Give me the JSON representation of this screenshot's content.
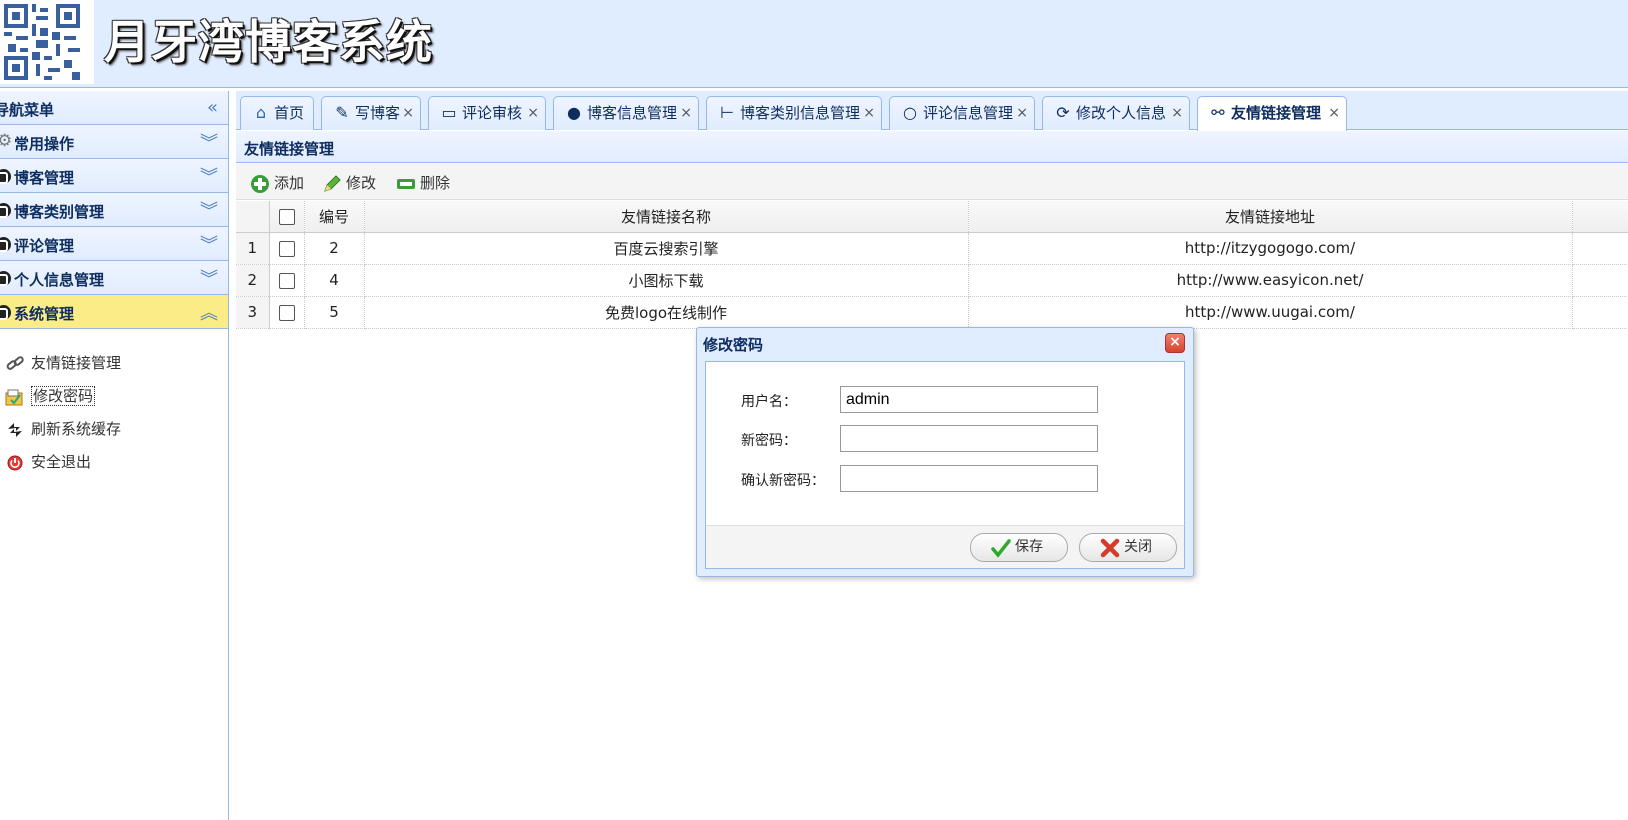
{
  "header": {
    "title": "月牙湾博客系统"
  },
  "sidebar": {
    "title": "导航菜单",
    "groups": [
      {
        "label": "常用操作"
      },
      {
        "label": "博客管理"
      },
      {
        "label": "博客类别管理"
      },
      {
        "label": "评论管理"
      },
      {
        "label": "个人信息管理"
      },
      {
        "label": "系统管理"
      }
    ],
    "items": [
      {
        "label": "友情链接管理",
        "icon": "link-icon"
      },
      {
        "label": "修改密码",
        "icon": "password-icon"
      },
      {
        "label": "刷新系统缓存",
        "icon": "refresh-icon"
      },
      {
        "label": "安全退出",
        "icon": "exit-icon"
      }
    ]
  },
  "tabs": [
    {
      "label": "首页",
      "icon": "home-icon"
    },
    {
      "label": "写博客",
      "icon": "write-icon"
    },
    {
      "label": "评论审核",
      "icon": "review-icon"
    },
    {
      "label": "博客信息管理",
      "icon": "blog-icon"
    },
    {
      "label": "博客类别信息管理",
      "icon": "tree-icon"
    },
    {
      "label": "评论信息管理",
      "icon": "comment-icon"
    },
    {
      "label": "修改个人信息",
      "icon": "reload-icon"
    },
    {
      "label": "友情链接管理",
      "icon": "link-icon"
    }
  ],
  "panel": {
    "title": "友情链接管理"
  },
  "toolbar": {
    "add": "添加",
    "edit": "修改",
    "delete": "删除"
  },
  "table": {
    "headers": [
      "编号",
      "友情链接名称",
      "友情链接地址"
    ],
    "rows": [
      {
        "rn": "1",
        "id": "2",
        "name": "百度云搜索引擎",
        "url": "http://itzygogogo.com/"
      },
      {
        "rn": "2",
        "id": "4",
        "name": "小图标下载",
        "url": "http://www.easyicon.net/"
      },
      {
        "rn": "3",
        "id": "5",
        "name": "免费logo在线制作",
        "url": "http://www.uugai.com/"
      }
    ]
  },
  "dialog": {
    "title": "修改密码",
    "fields": {
      "username_label": "用户名：",
      "username_value": "admin",
      "newpwd_label": "新密码：",
      "confirm_label": "确认新密码："
    },
    "save": "保存",
    "close": "关闭"
  },
  "colors": {
    "accent": "#95b8e7",
    "header_bg": "#e0ecff",
    "active_group": "#fbec88"
  }
}
